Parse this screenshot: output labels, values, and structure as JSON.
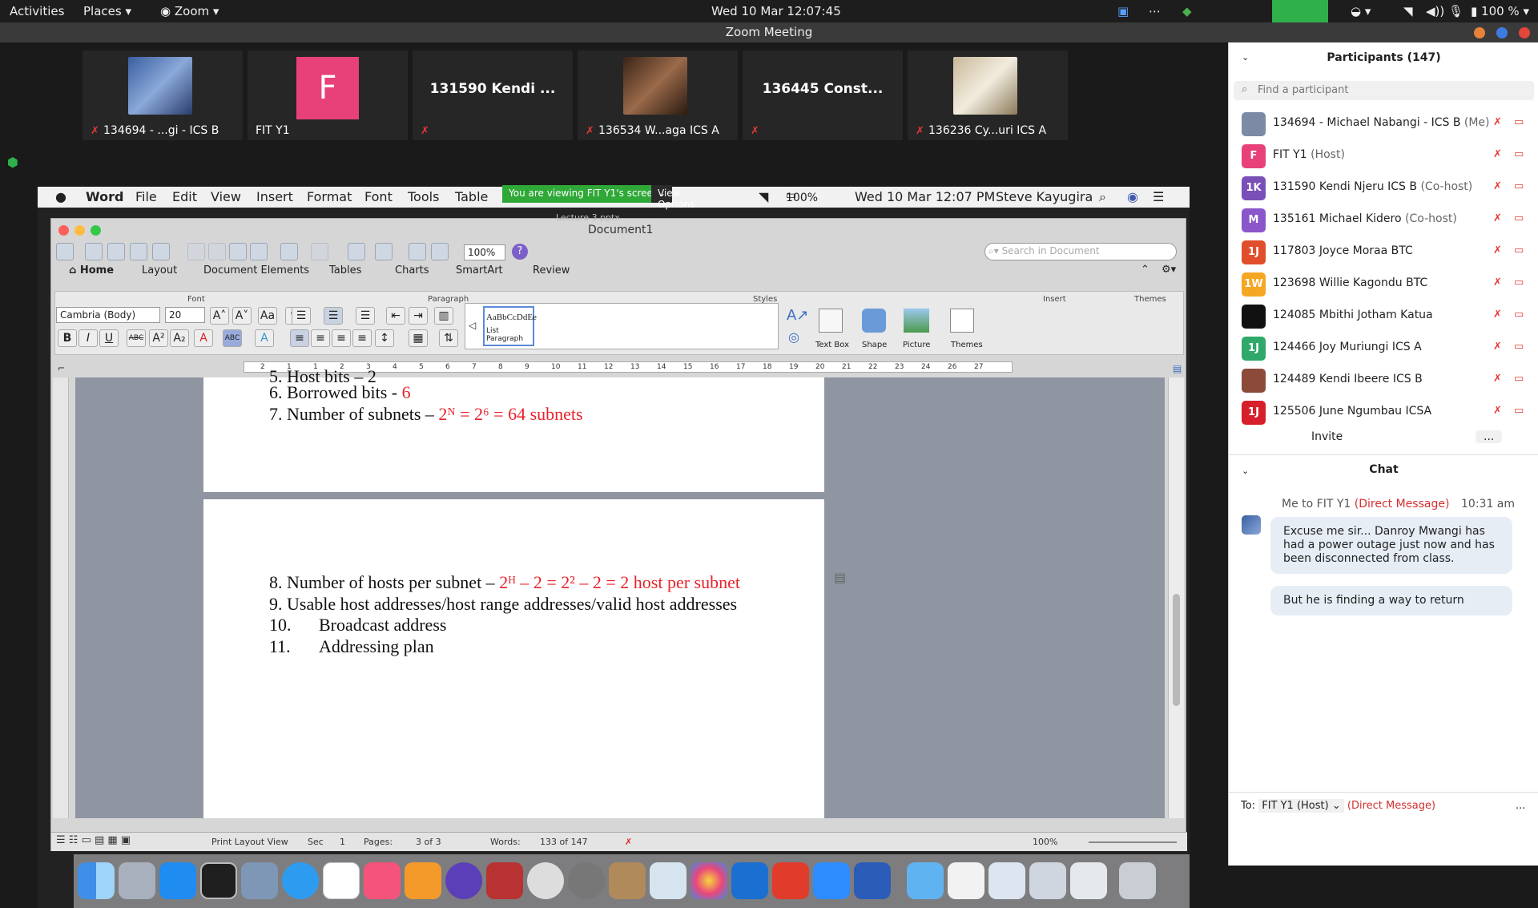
{
  "topbar": {
    "activities": "Activities",
    "places": "Places",
    "app": "Zoom",
    "clock": "Wed 10 Mar  12:07:45",
    "battery": "100 %"
  },
  "zoom": {
    "title": "Zoom Meeting"
  },
  "tiles": [
    {
      "name": "134694 - ...gi - ICS B",
      "big": ""
    },
    {
      "name": "FIT Y1",
      "big": "F"
    },
    {
      "name": "",
      "big": "131590 Kendi ..."
    },
    {
      "name": "136534 W...aga ICS A",
      "big": ""
    },
    {
      "name": "",
      "big": "136445 Const..."
    },
    {
      "name": "136236 Cy...uri  ICS A",
      "big": ""
    }
  ],
  "mac": {
    "apple": "",
    "app": "Word",
    "menus": [
      "File",
      "Edit",
      "View",
      "Insert",
      "Format",
      "Font",
      "Tools",
      "Table"
    ],
    "viewing": "You are viewing FIT Y1's screen",
    "view_options": "View Options",
    "battery": "100%",
    "clock": "Wed 10 Mar  12:07 PM",
    "user": "Steve Kayugira"
  },
  "word": {
    "doc_title": "Document1",
    "faded_title": "Lecture 3.pptx",
    "zoom": "100%",
    "search_placeholder": "Search in Document",
    "tabs": [
      "Home",
      "Layout",
      "Document Elements",
      "Tables",
      "Charts",
      "SmartArt",
      "Review"
    ],
    "groups": {
      "font": "Font",
      "paragraph": "Paragraph",
      "styles": "Styles",
      "insert": "Insert",
      "themes": "Themes"
    },
    "font_name": "Cambria (Body)",
    "font_size": "20",
    "style_sample": "AaBbCcDdEe",
    "style_name": "List Paragraph",
    "insert_items": [
      "Text Box",
      "Shape",
      "Picture"
    ],
    "themes_label": "Themes",
    "ruler_numbers": [
      "2",
      "1",
      "1",
      "2",
      "3",
      "4",
      "5",
      "6",
      "7",
      "8",
      "9",
      "10",
      "11",
      "12",
      "13",
      "14",
      "15",
      "16",
      "17",
      "18",
      "19",
      "20",
      "21",
      "22",
      "23",
      "24",
      "26",
      "27"
    ],
    "page1": {
      "l5": "5. Host bits – 2",
      "l6": "6. Borrowed bits - ",
      "l6v": "6",
      "l7": "7. Number of subnets – ",
      "l7v": "2ᴺ = 2⁶ = 64 subnets"
    },
    "page2": {
      "l8": "8. Number of hosts per subnet – ",
      "l8v": "2ᴴ – 2 = 2² – 2 = 2 host per subnet",
      "l9": "9. Usable host addresses/host range addresses/valid host addresses",
      "l10n": "10.",
      "l10": "Broadcast address",
      "l11n": "11.",
      "l11": "Addressing plan"
    },
    "status": {
      "view": "Print Layout View",
      "sec_label": "Sec",
      "sec": "1",
      "pages_label": "Pages:",
      "pages": "3 of 3",
      "words_label": "Words:",
      "words": "133 of 147",
      "zoom": "100%"
    }
  },
  "participants": {
    "title": "Participants (147)",
    "find": "Find a participant",
    "rows": [
      {
        "av": "",
        "name": "134694 - Michael Nabangi - ICS B",
        "tag": " (Me)",
        "color": "#7d8aa6"
      },
      {
        "av": "F",
        "name": "FIT Y1",
        "tag": " (Host)",
        "color": "#e8417a"
      },
      {
        "av": "1K",
        "name": "131590 Kendi Njeru ICS B",
        "tag": " (Co-host)",
        "color": "#7b4fb8"
      },
      {
        "av": "M",
        "name": "135161 Michael Kidero",
        "tag": " (Co-host)",
        "color": "#8a56c9"
      },
      {
        "av": "1J",
        "name": "117803 Joyce Moraa BTC",
        "tag": "",
        "color": "#e04e2b"
      },
      {
        "av": "1W",
        "name": "123698 Willie Kagondu BTC",
        "tag": "",
        "color": "#f5a623"
      },
      {
        "av": "",
        "name": "124085 Mbithi Jotham Katua",
        "tag": "",
        "color": "#111111"
      },
      {
        "av": "1J",
        "name": "124466 Joy Muriungi ICS A",
        "tag": "",
        "color": "#2fa86a"
      },
      {
        "av": "",
        "name": "124489 Kendi Ibeere ICS B",
        "tag": "",
        "color": "#8b4a3a"
      },
      {
        "av": "1J",
        "name": "125506 June Ngumbau ICSA",
        "tag": "",
        "color": "#d61f2a"
      }
    ],
    "invite": "Invite",
    "more": "..."
  },
  "chat": {
    "title": "Chat",
    "from": "Me to FIT Y1",
    "dm": "(Direct Message)",
    "time": "10:31 am",
    "msg1": "Excuse me sir... Danroy Mwangi has had a power outage just now and has been disconnected from class.",
    "msg2": "But he is finding a way to return",
    "to_label": "To:",
    "to_value": "FIT Y1 (Host)",
    "to_dm": "(Direct Message)",
    "more": "..."
  }
}
